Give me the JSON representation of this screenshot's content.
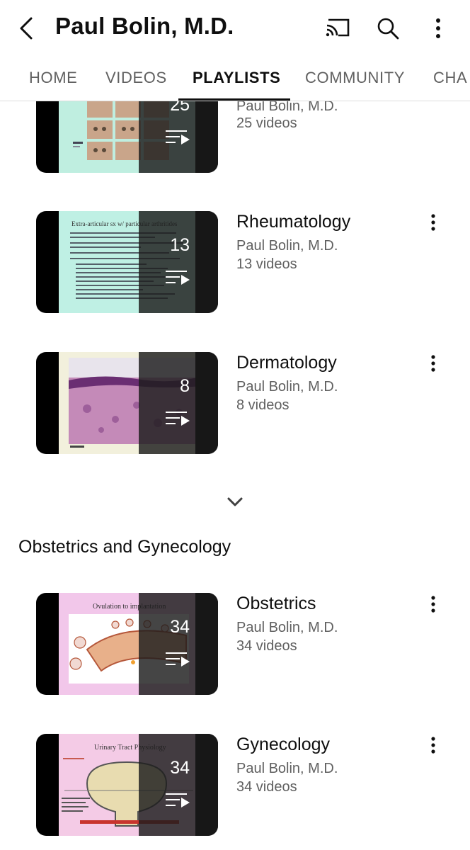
{
  "header": {
    "title": "Paul Bolin, M.D.",
    "back_icon": "chevron-left-icon",
    "cast_icon": "cast-icon",
    "search_icon": "search-icon",
    "more_icon": "more-vertical-icon"
  },
  "tabs": [
    {
      "label": "HOME"
    },
    {
      "label": "VIDEOS"
    },
    {
      "label": "PLAYLISTS",
      "active": true
    },
    {
      "label": "COMMUNITY"
    },
    {
      "label": "CHA"
    }
  ],
  "sections": [
    {
      "title": "",
      "playlists": [
        {
          "title": "",
          "author": "Paul Bolin, M.D.",
          "video_count_text": "25 videos",
          "count": "25"
        },
        {
          "title": "Rheumatology",
          "author": "Paul Bolin, M.D.",
          "video_count_text": "13 videos",
          "count": "13",
          "thumb_heading": "Extra-articular sx w/ particular arthritides"
        },
        {
          "title": "Dermatology",
          "author": "Paul Bolin, M.D.",
          "video_count_text": "8 videos",
          "count": "8"
        }
      ]
    },
    {
      "title": "Obstetrics and Gynecology",
      "playlists": [
        {
          "title": "Obstetrics",
          "author": "Paul Bolin, M.D.",
          "video_count_text": "34 videos",
          "count": "34",
          "thumb_heading": "Ovulation to implantation"
        },
        {
          "title": "Gynecology",
          "author": "Paul Bolin, M.D.",
          "video_count_text": "34 videos",
          "count": "34",
          "thumb_heading": "Urinary Tract Physiology"
        }
      ]
    }
  ],
  "expand_icon": "chevron-down-icon",
  "colors": {
    "text": "#0f0f0f",
    "secondary": "#606060",
    "overlay": "#1c1c1c"
  }
}
